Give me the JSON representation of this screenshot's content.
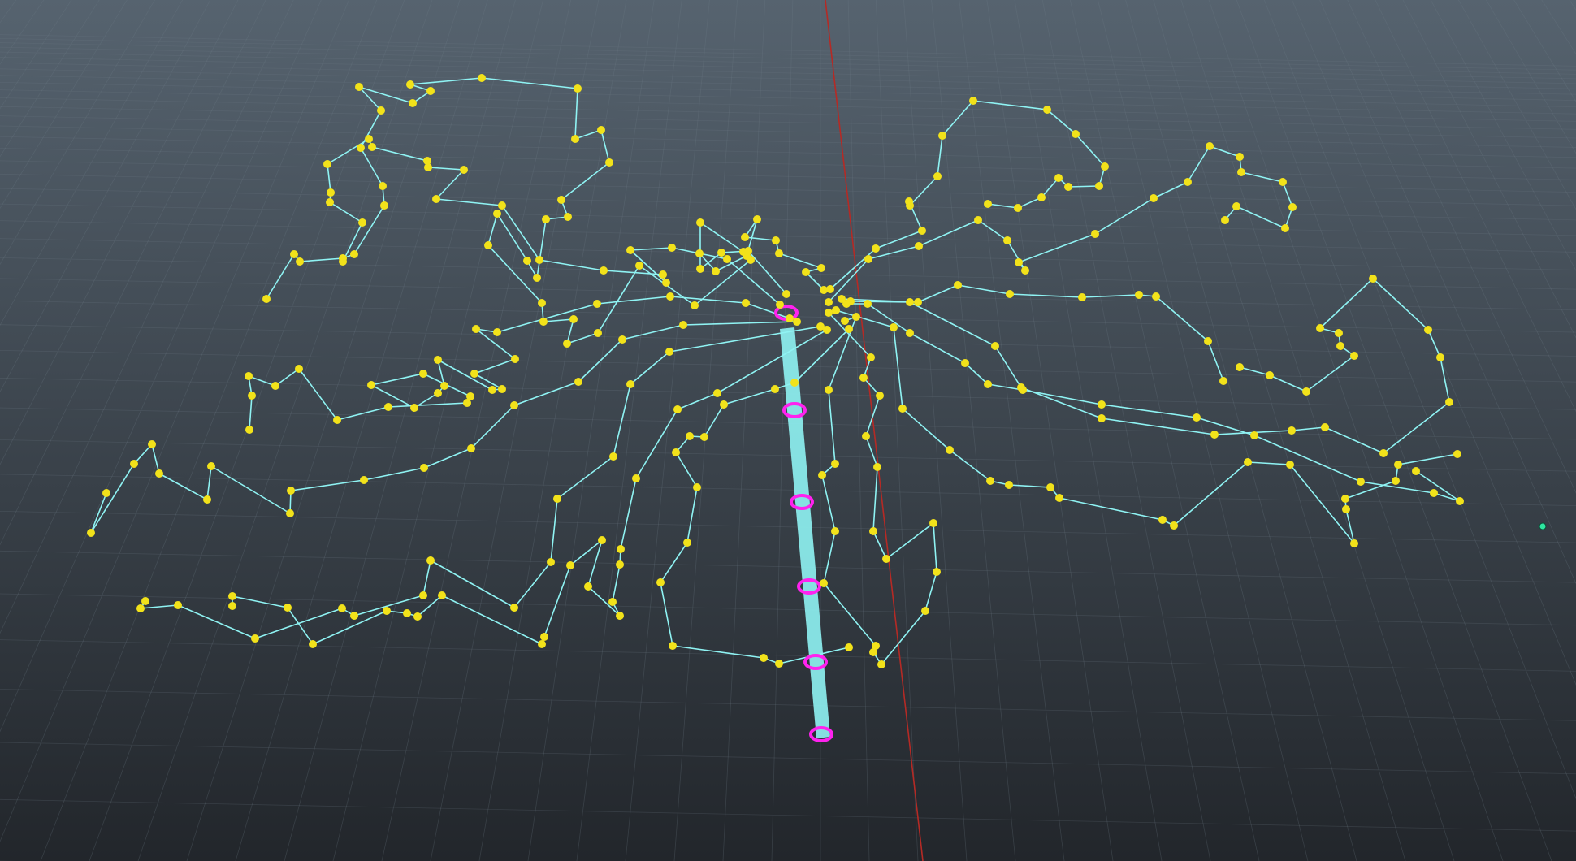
{
  "viewport": {
    "name": "3d-viewport",
    "colors": {
      "bg_top": "#56636f",
      "bg_bottom": "#22262b",
      "grid": "#6f7c88",
      "axis": "#b52a25",
      "curve": "#8ff3f3",
      "cv_point": "#f2e21a",
      "joint": "#ff22ee",
      "locator": "#2ee6a0"
    }
  }
}
